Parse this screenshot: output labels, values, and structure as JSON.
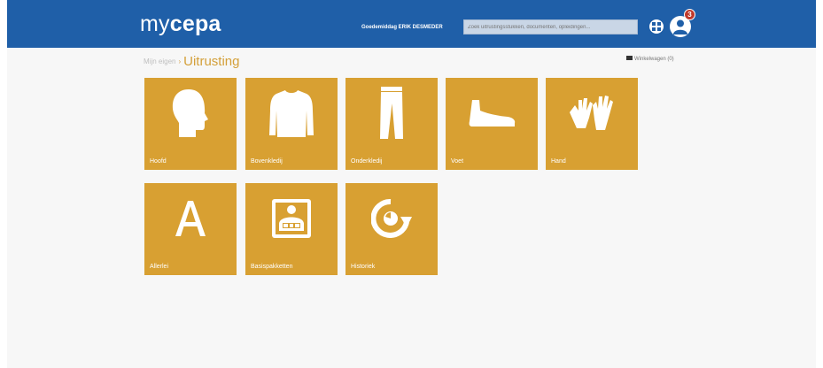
{
  "header": {
    "logo_prefix": "my",
    "logo_suffix": "cepa",
    "user_label": "Goedemiddag ERIK DESMEDER",
    "search_placeholder": "Zoek uitrustingsstukken, documenten, opleidingen...",
    "notification_count": "3"
  },
  "breadcrumb": {
    "home": "Mijn eigen",
    "separator": "›",
    "current": "Uitrusting"
  },
  "cart": {
    "label": "Winkelwagen (0)"
  },
  "tiles": [
    {
      "label": "Hoofd",
      "icon": "head-icon"
    },
    {
      "label": "Bovenkledij",
      "icon": "shirt-icon"
    },
    {
      "label": "Onderkledij",
      "icon": "trousers-icon"
    },
    {
      "label": "Voet",
      "icon": "foot-icon"
    },
    {
      "label": "Hand",
      "icon": "gloves-icon"
    },
    {
      "label": "Allerlei",
      "icon": "letter-a-icon"
    },
    {
      "label": "Basispakketten",
      "icon": "package-icon"
    },
    {
      "label": "Historiek",
      "icon": "history-icon"
    }
  ],
  "colors": {
    "header": "#1f5fa8",
    "tile": "#d8a032",
    "accent": "#d4a03a",
    "badge": "#c0392b"
  }
}
